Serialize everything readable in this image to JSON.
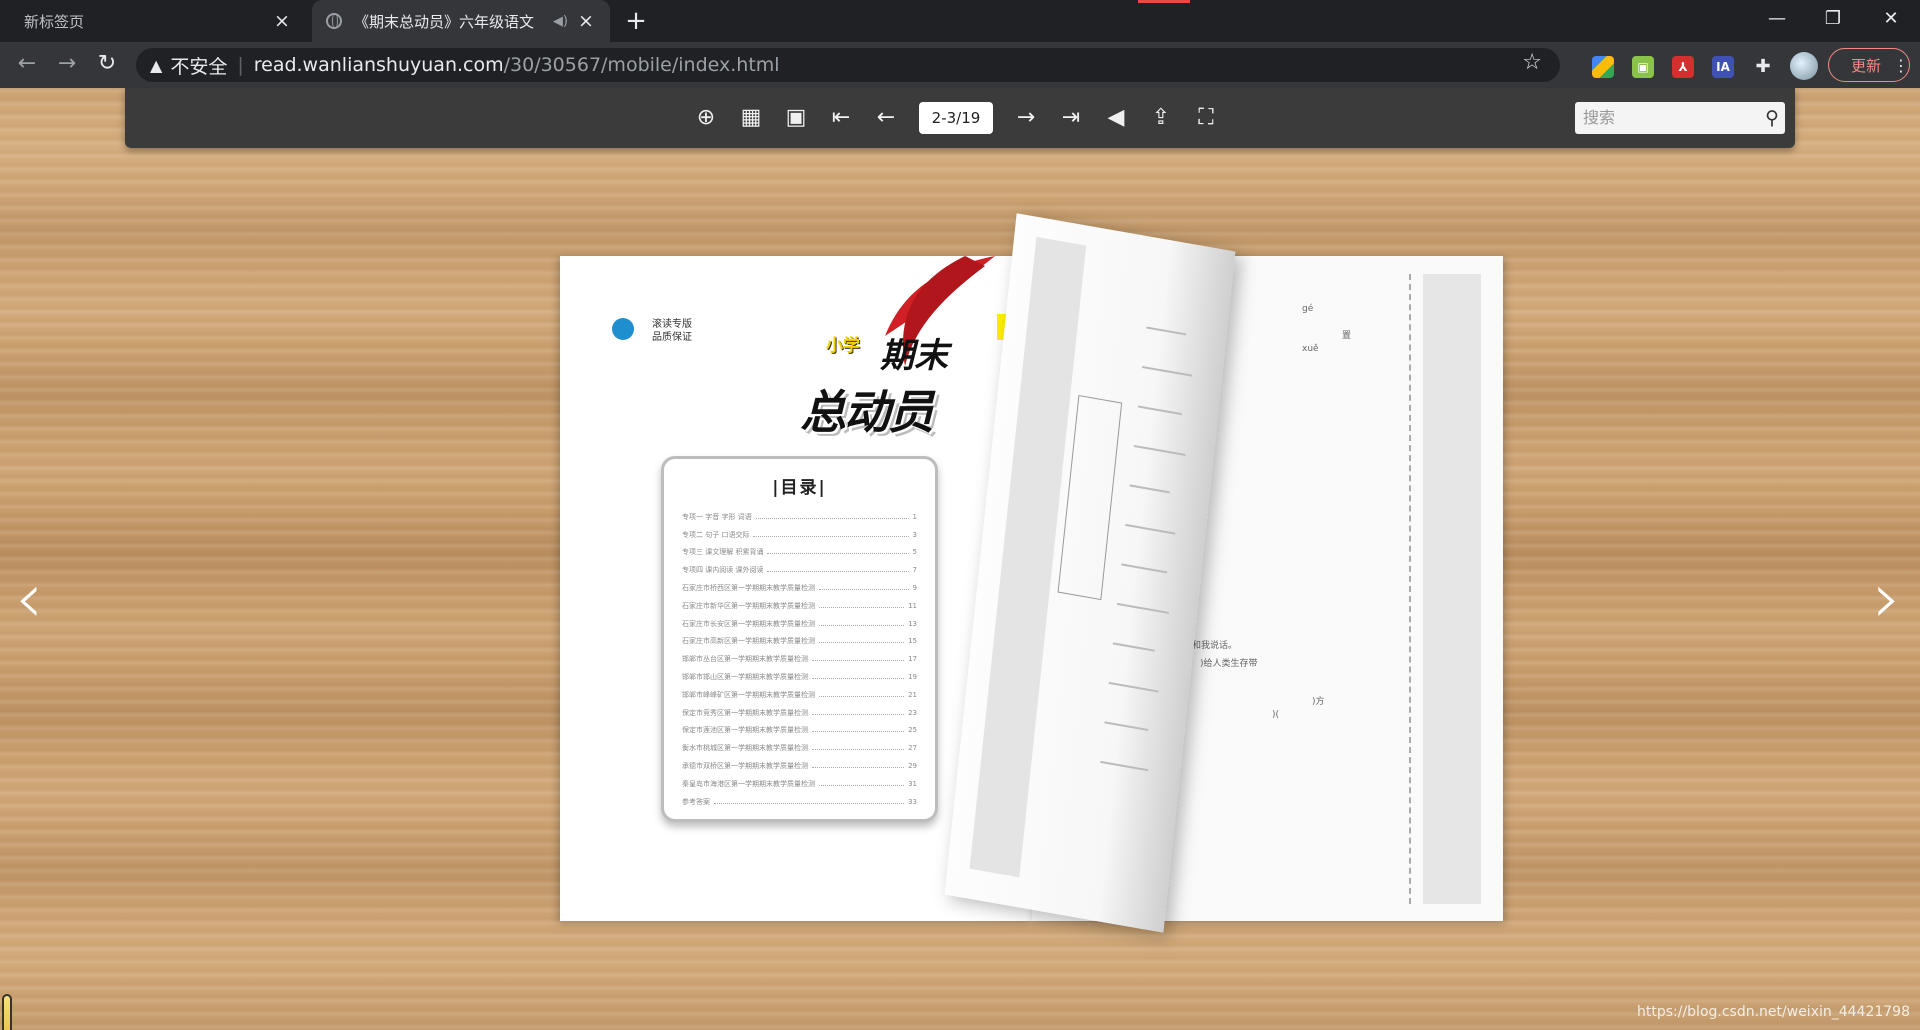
{
  "browser": {
    "tabs": [
      {
        "title": "新标签页",
        "active": false
      },
      {
        "title": "《期末总动员》六年级语文",
        "active": true
      }
    ],
    "new_tab_label": "+",
    "address": {
      "security_label": "不安全",
      "host": "read.wanlianshuyuan.com",
      "path": "/30/30567/mobile/index.html"
    },
    "update_label": "更新",
    "extensions": [
      "color-palette-ext",
      "image-ext",
      "pdf-ext",
      "IA",
      "puzzle-ext",
      "profile-avatar"
    ]
  },
  "viewer": {
    "page_indicator": "2-3/19",
    "search_placeholder": "搜索",
    "tools": [
      "zoom-in",
      "thumbnails",
      "single-page",
      "first-page",
      "prev-page",
      "next-page",
      "last-page",
      "sound",
      "share",
      "fullscreen"
    ]
  },
  "book": {
    "publisher_slogan": [
      "滚读专版",
      "品质保证"
    ],
    "brand_small": "小学",
    "brand_big": "总动员",
    "brand_top": "期末",
    "toc_title": "|目录|",
    "toc_items": [
      {
        "label": "专项一  字音  字形  词语",
        "page": "1"
      },
      {
        "label": "专项二  句子  口语交际",
        "page": "3"
      },
      {
        "label": "专项三  课文理解  积累背诵",
        "page": "5"
      },
      {
        "label": "专项四  课内阅读  课外阅读",
        "page": "7"
      },
      {
        "label": "石家庄市桥西区第一学期期末教学质量检测",
        "page": "9"
      },
      {
        "label": "石家庄市新华区第一学期期末教学质量检测",
        "page": "11"
      },
      {
        "label": "石家庄市长安区第一学期期末教学质量检测",
        "page": "13"
      },
      {
        "label": "石家庄市高新区第一学期期末教学质量检测",
        "page": "15"
      },
      {
        "label": "邯郸市丛台区第一学期期末教学质量检测",
        "page": "17"
      },
      {
        "label": "邯郸市邯山区第一学期期末教学质量检测",
        "page": "19"
      },
      {
        "label": "邯郸市峰峰矿区第一学期期末教学质量检测",
        "page": "21"
      },
      {
        "label": "保定市竞秀区第一学期期末教学质量检测",
        "page": "23"
      },
      {
        "label": "保定市莲池区第一学期期末教学质量检测",
        "page": "25"
      },
      {
        "label": "衡水市桃城区第一学期期末教学质量检测",
        "page": "27"
      },
      {
        "label": "承德市双桥区第一学期期末教学质量检测",
        "page": "29"
      },
      {
        "label": "秦皇岛市海港区第一学期期末教学质量检测",
        "page": "31"
      },
      {
        "label": "参考答案",
        "page": "33"
      }
    ],
    "right_page_snippets": [
      "gé",
      "xuě",
      "置",
      "和我说话。",
      ")给人类生存带",
      ")方",
      ")("
    ]
  },
  "watermark": "https://blog.csdn.net/weixin_44421798",
  "colors": {
    "chrome_bg": "#202124",
    "toolbar_bg": "#35363a",
    "flip_toolbar": "#3b3b3b",
    "update_accent": "#f28b82"
  }
}
